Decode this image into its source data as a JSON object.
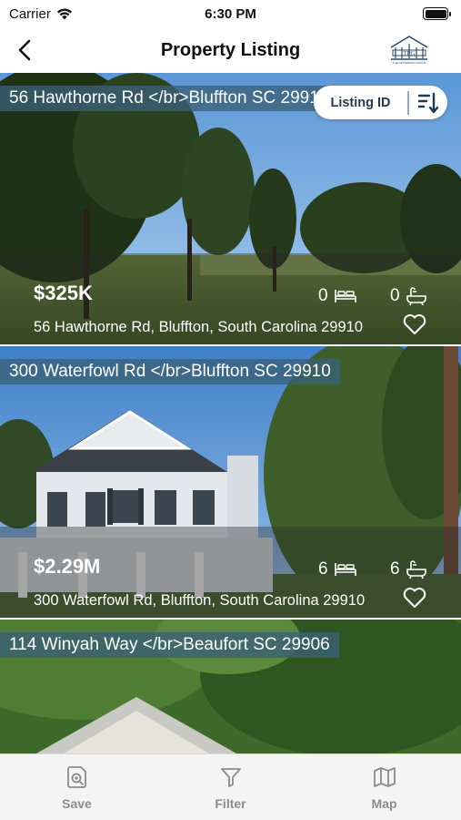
{
  "status_bar": {
    "carrier": "Carrier",
    "time": "6:30 PM"
  },
  "nav": {
    "title": "Property Listing",
    "logo_text": "THE PATTERSON GROUP"
  },
  "sort": {
    "label": "Listing ID"
  },
  "listings": [
    {
      "title": "56 Hawthorne Rd </br>Bluffton SC 29910",
      "price": "$325K",
      "beds": "0",
      "baths": "0",
      "address": "56 Hawthorne Rd, Bluffton, South Carolina 29910"
    },
    {
      "title": "300 Waterfowl Rd </br>Bluffton SC 29910",
      "price": "$2.29M",
      "beds": "6",
      "baths": "6",
      "address": "300 Waterfowl Rd, Bluffton, South Carolina 29910"
    },
    {
      "title": "114 Winyah Way </br>Beaufort SC 29906"
    }
  ],
  "tabs": [
    {
      "label": "Save",
      "icon": "save-search-icon"
    },
    {
      "label": "Filter",
      "icon": "filter-icon"
    },
    {
      "label": "Map",
      "icon": "map-icon"
    }
  ]
}
